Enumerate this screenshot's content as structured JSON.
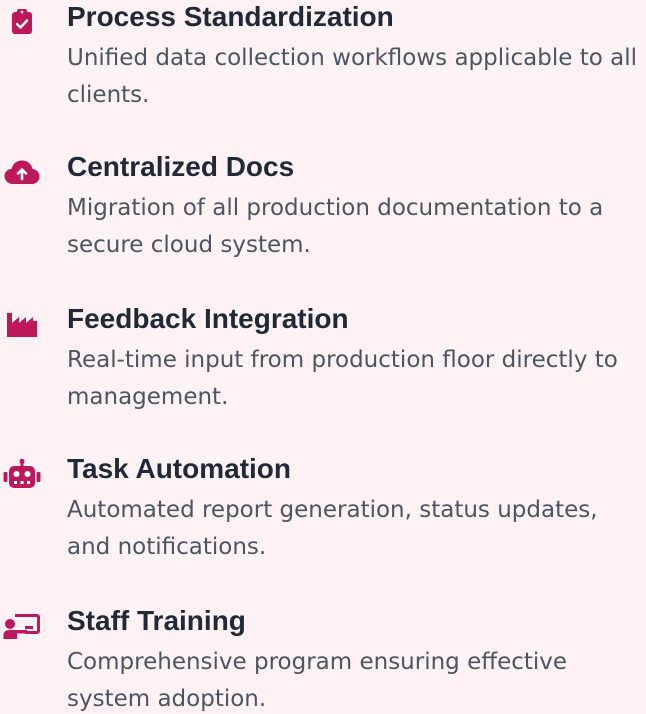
{
  "accent_color": "#be185d",
  "items": [
    {
      "icon": "clipboard-check-icon",
      "title": "Process Standardization",
      "description": "Unified data collection workflows applicable to all clients."
    },
    {
      "icon": "cloud-upload-icon",
      "title": "Centralized Docs",
      "description": "Migration of all production documentation to a secure cloud system."
    },
    {
      "icon": "factory-icon",
      "title": "Feedback Integration",
      "description": "Real-time input from production floor directly to management."
    },
    {
      "icon": "robot-icon",
      "title": "Task Automation",
      "description": "Automated report generation, status updates, and notifications."
    },
    {
      "icon": "chalkboard-teacher-icon",
      "title": "Staff Training",
      "description": "Comprehensive program ensuring effective system adoption."
    }
  ]
}
